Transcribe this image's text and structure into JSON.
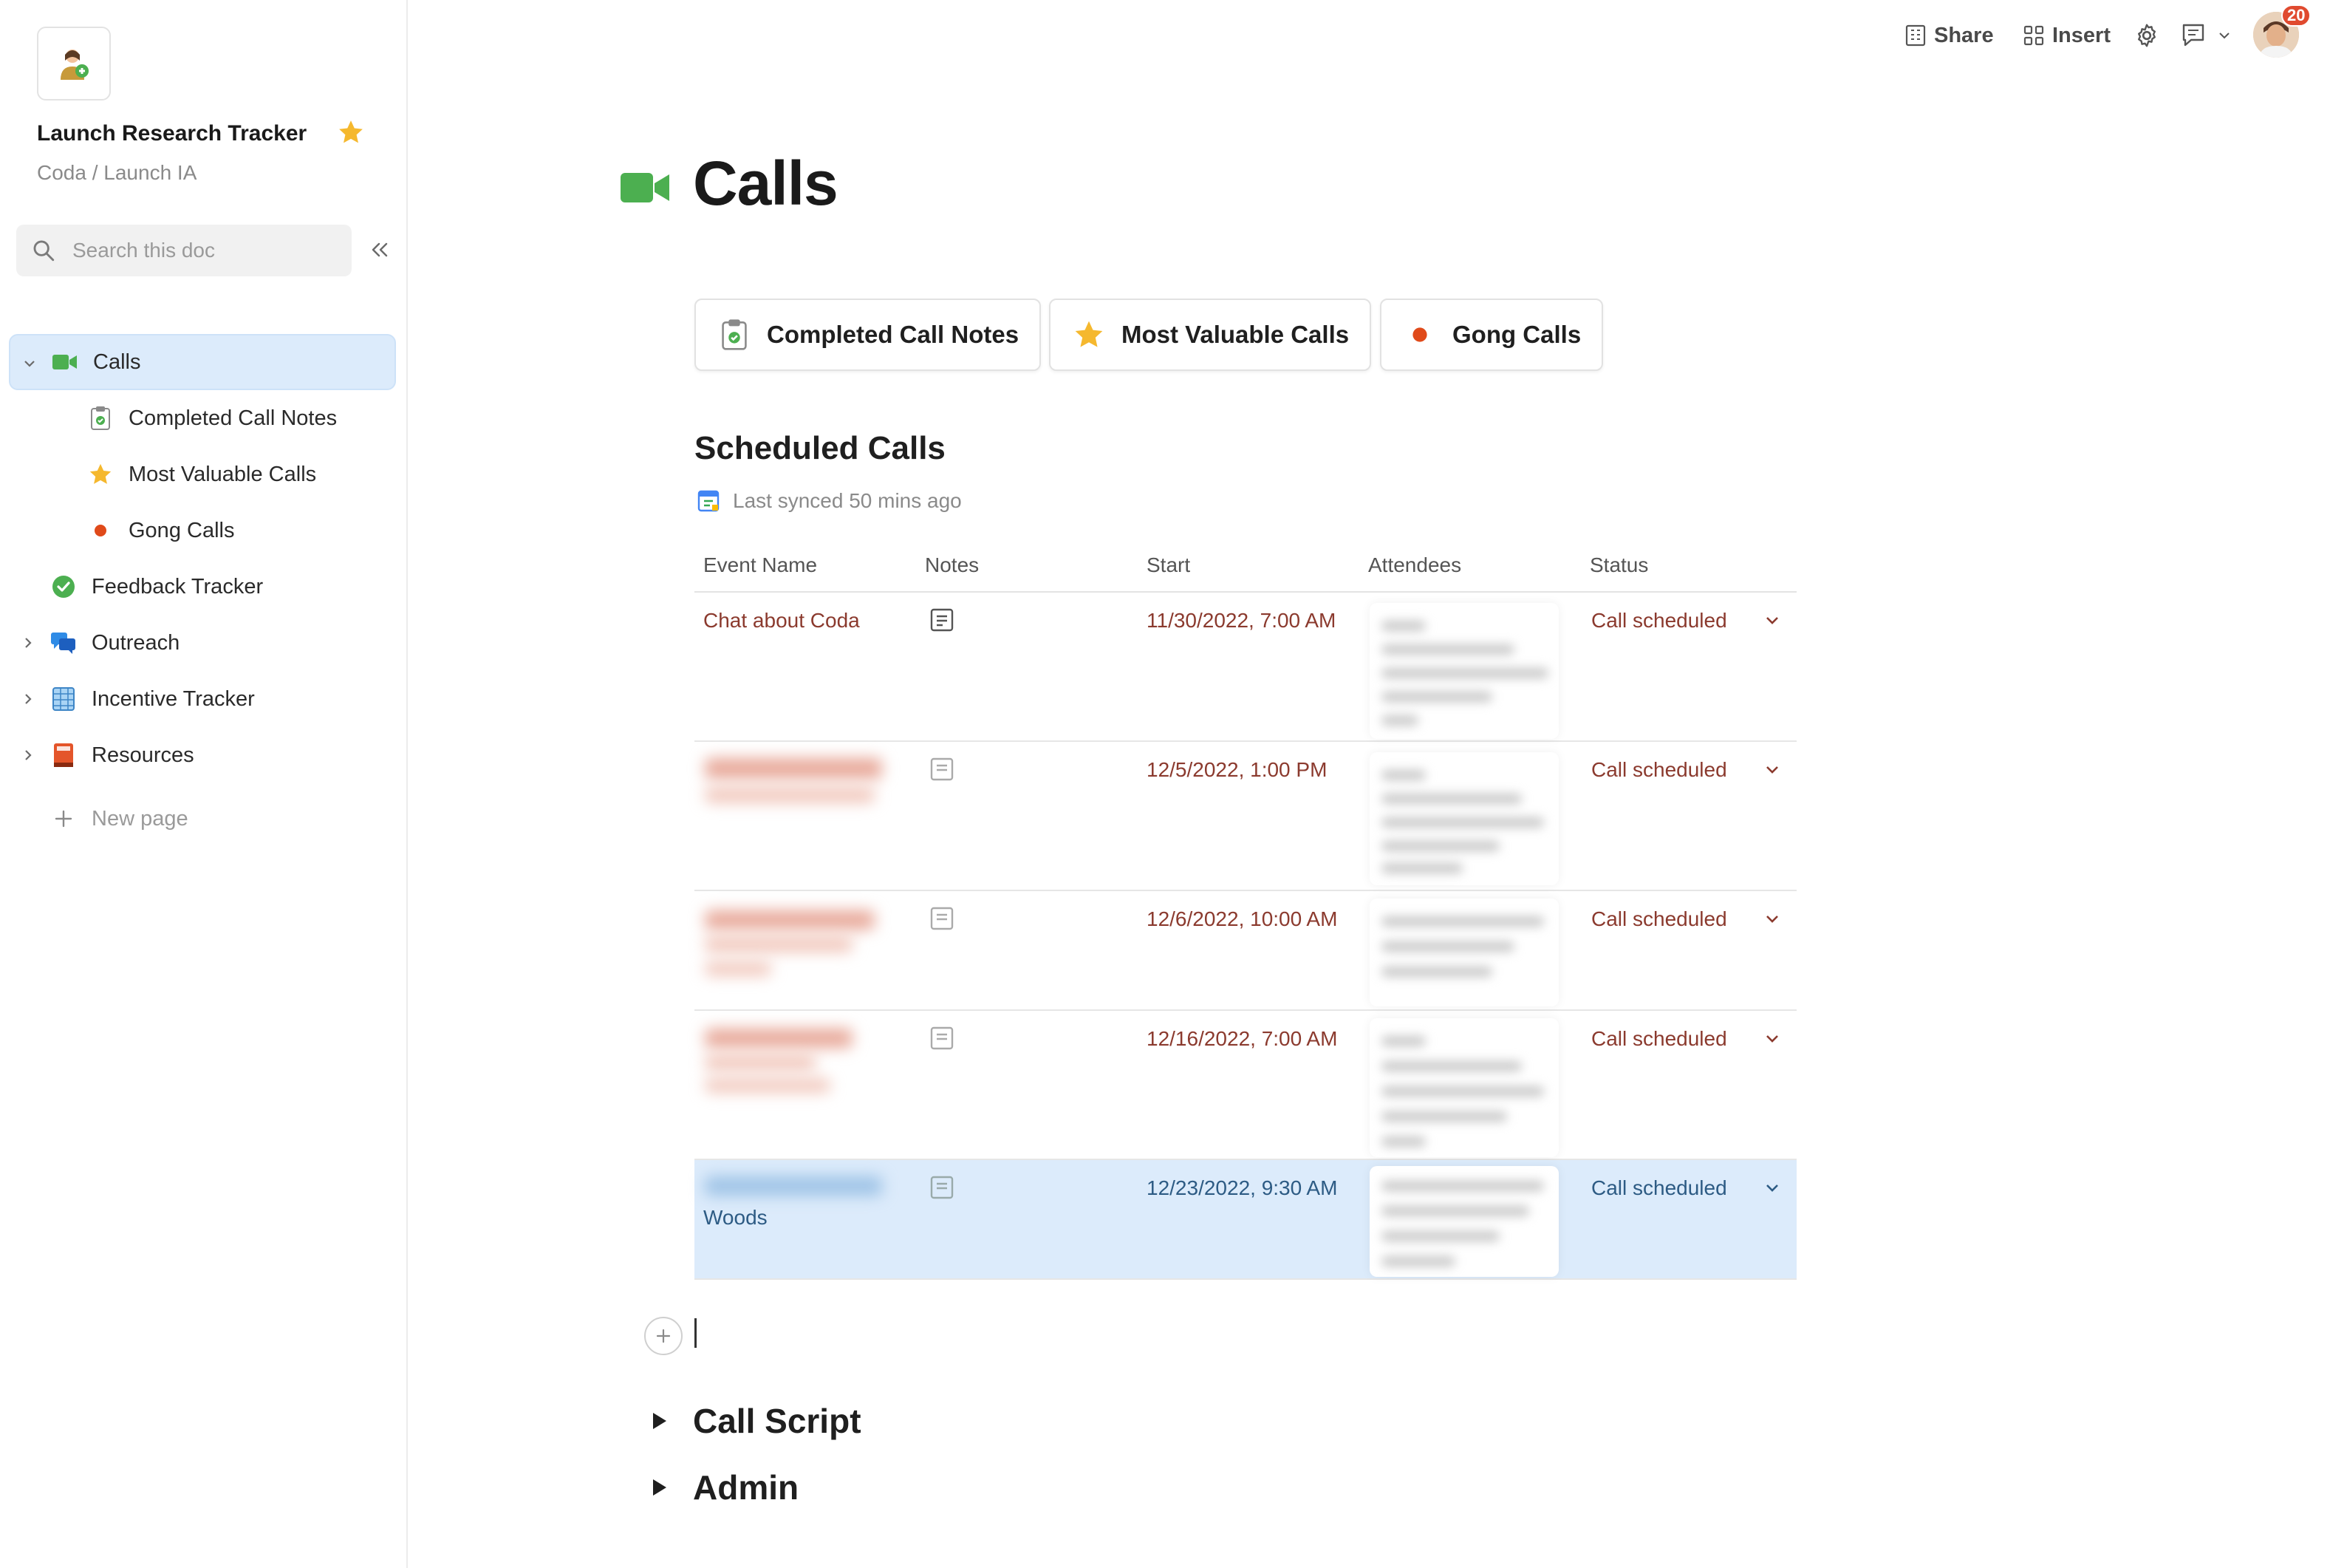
{
  "doc": {
    "title": "Launch Research Tracker",
    "path": "Coda / Launch IA",
    "search_placeholder": "Search this doc"
  },
  "sidebar": {
    "items": [
      {
        "label": "Calls"
      },
      {
        "label": "Completed Call Notes"
      },
      {
        "label": "Most Valuable Calls"
      },
      {
        "label": "Gong Calls"
      },
      {
        "label": "Feedback Tracker"
      },
      {
        "label": "Outreach"
      },
      {
        "label": "Incentive Tracker"
      },
      {
        "label": "Resources"
      }
    ],
    "new_page": "New page"
  },
  "topbar": {
    "share": "Share",
    "insert": "Insert",
    "notification_count": "20"
  },
  "page": {
    "title": "Calls",
    "chips": [
      {
        "label": "Completed Call Notes",
        "icon": "clipboard-check-icon"
      },
      {
        "label": "Most Valuable Calls",
        "icon": "star-icon"
      },
      {
        "label": "Gong Calls",
        "icon": "red-dot-icon"
      }
    ]
  },
  "table": {
    "title": "Scheduled Calls",
    "sync_text": "Last synced 50 mins ago",
    "columns": [
      "Event Name",
      "Notes",
      "Start",
      "Attendees",
      "Status"
    ],
    "rows": [
      {
        "event": "Chat about Coda",
        "start": "11/30/2022, 7:00 AM",
        "status": "Call scheduled"
      },
      {
        "event": "",
        "start": "12/5/2022, 1:00 PM",
        "status": "Call scheduled"
      },
      {
        "event": "",
        "start": "12/6/2022, 10:00 AM",
        "status": "Call scheduled"
      },
      {
        "event": "",
        "start": "12/16/2022, 7:00 AM",
        "status": "Call scheduled"
      },
      {
        "event": "Woods",
        "start": "12/23/2022, 9:30 AM",
        "status": "Call scheduled"
      }
    ]
  },
  "sections": [
    {
      "label": "Call Script"
    },
    {
      "label": "Admin"
    }
  ],
  "colors": {
    "accent_blue": "#dcebfb",
    "link_red": "#8b3a2e",
    "camera_green": "#4caf50",
    "badge_red": "#e04a2f"
  }
}
